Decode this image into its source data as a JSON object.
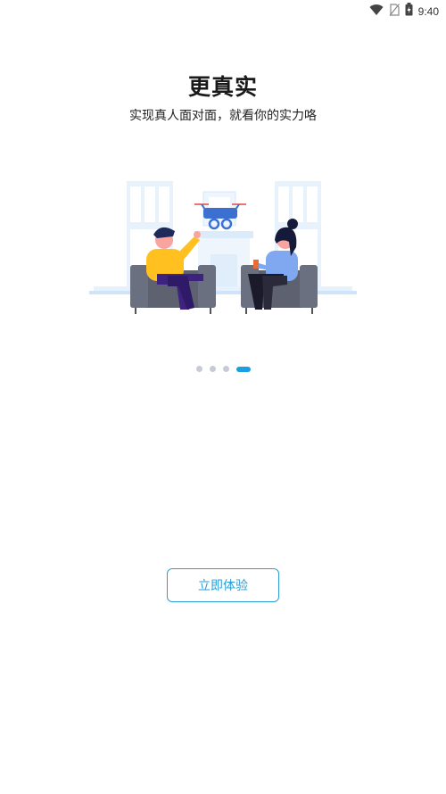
{
  "status_bar": {
    "time": "9:40",
    "icons": [
      "wifi-icon",
      "no-sim-icon",
      "battery-charging-icon"
    ]
  },
  "onboarding": {
    "title": "更真实",
    "subtitle": "实现真人面对面，就看你的实力咯",
    "page_indicator": {
      "total": 4,
      "active_index": 3
    },
    "cta_label": "立即体验"
  },
  "colors": {
    "accent": "#1aa0e0",
    "button_border": "#2a9fd6",
    "dot_inactive": "#c7cbd6"
  }
}
